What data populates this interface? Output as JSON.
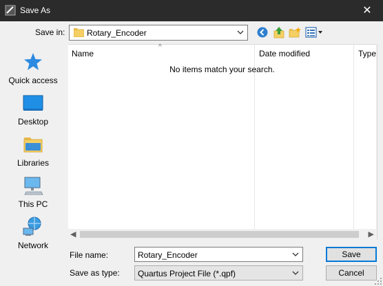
{
  "window": {
    "title": "Save As",
    "close_glyph": "✕"
  },
  "save_in": {
    "label": "Save in:",
    "value": "Rotary_Encoder"
  },
  "toolbar": {
    "icons": [
      "back-icon",
      "up-folder-icon",
      "new-folder-icon",
      "view-menu-icon"
    ]
  },
  "places": [
    {
      "label": "Quick access",
      "icon": "star-icon"
    },
    {
      "label": "Desktop",
      "icon": "desktop-icon"
    },
    {
      "label": "Libraries",
      "icon": "libraries-icon"
    },
    {
      "label": "This PC",
      "icon": "computer-icon"
    },
    {
      "label": "Network",
      "icon": "network-icon"
    }
  ],
  "list": {
    "columns": [
      "Name",
      "Date modified",
      "Type"
    ],
    "empty_message": "No items match your search."
  },
  "file_name": {
    "label": "File name:",
    "value": "Rotary_Encoder"
  },
  "save_as_type": {
    "label": "Save as type:",
    "value": "Quartus Project File (*.qpf)"
  },
  "buttons": {
    "save": "Save",
    "cancel": "Cancel"
  },
  "colors": {
    "titlebar": "#2b2b2b",
    "accent": "#0078d7",
    "dialog_bg": "#f0f0f0"
  }
}
